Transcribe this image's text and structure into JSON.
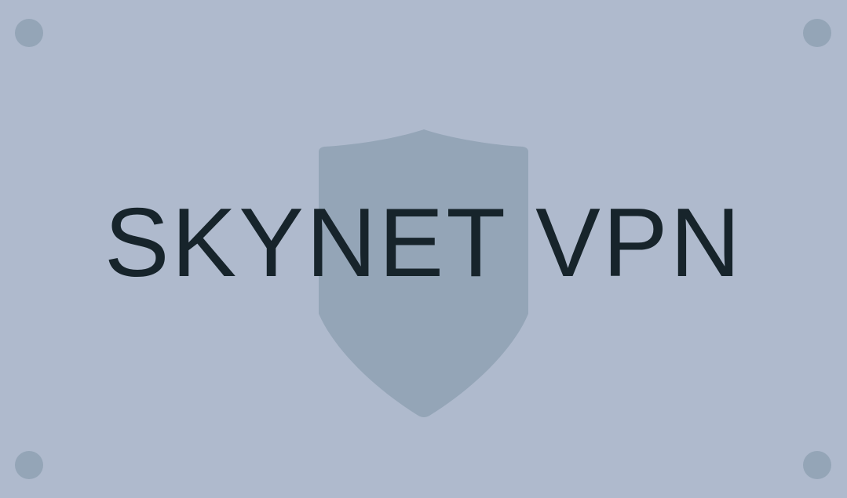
{
  "brand": {
    "name": "SKYNET VPN",
    "logo_icon": "shield-icon",
    "text_color": "#17242b",
    "background_color": "#afbacd",
    "shield_color": "#94a5b7",
    "corner_dot_color": "#94a5b7"
  }
}
